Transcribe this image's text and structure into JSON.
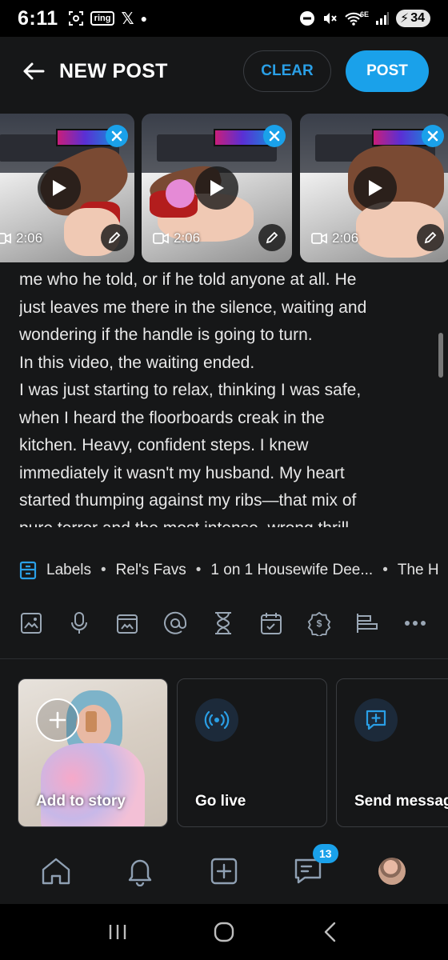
{
  "status_bar": {
    "time": "6:11",
    "ring_label": "ring",
    "x_label": "𝕏",
    "network_label": "6E",
    "battery": "34"
  },
  "header": {
    "title": "NEW POST",
    "clear_label": "CLEAR",
    "post_label": "POST"
  },
  "media": [
    {
      "duration": "2:06"
    },
    {
      "duration": "2:06"
    },
    {
      "duration": "2:06"
    }
  ],
  "post_text": [
    "me who he told, or if he told anyone at all. He",
    "just leaves me there in the silence, waiting and",
    "wondering if the handle is going to turn.",
    "In this video, the waiting ended.",
    "I was just starting to relax, thinking I was safe,",
    "when I heard the floorboards creak in the",
    "kitchen. Heavy, confident steps. I knew",
    "immediately it wasn't my husband. My heart",
    "started thumping against my ribs—that mix of",
    "pure terror and the most intense, wrong thrill."
  ],
  "labels": {
    "title": "Labels",
    "items": [
      "Rel's Favs",
      "1 on 1 Housewife Dee...",
      "The H"
    ]
  },
  "toolbar_icons": [
    "image-icon",
    "microphone-icon",
    "gif-icon",
    "mention-icon",
    "timer-icon",
    "schedule-icon",
    "price-icon",
    "poll-icon",
    "more-icon"
  ],
  "stories": {
    "add": "Add to story",
    "live": "Go live",
    "message": "Send message"
  },
  "bottom_nav": {
    "badge": "13"
  },
  "colors": {
    "accent": "#1aa1ea",
    "background": "#161718"
  }
}
